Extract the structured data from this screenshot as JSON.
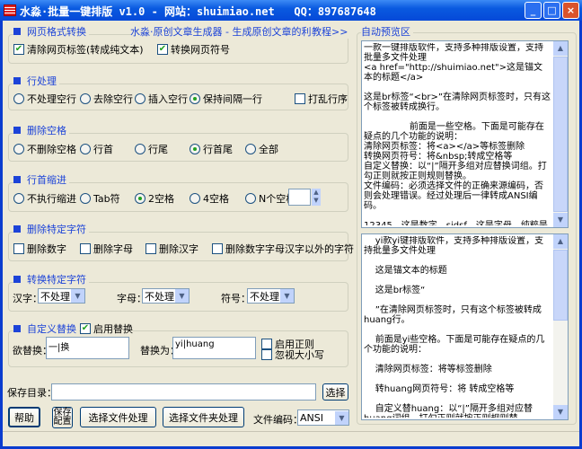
{
  "window": {
    "title": "水淼·批量一键排版 v1.0 - 网站：shuimiao.net   QQ：897687648",
    "minimize": "_",
    "maximize": "□",
    "close": "×"
  },
  "web_format": {
    "title": "网页格式转换",
    "promo_link": "水淼·原创文章生成器 - 生成原创文章的利器！",
    "tutorial_link": "教程>>",
    "options": [
      {
        "label": "清除网页标签(转成纯文本)",
        "checked": true
      },
      {
        "label": "转换网页符号",
        "checked": true
      }
    ]
  },
  "line_process": {
    "title": "行处理",
    "options": [
      {
        "label": "不处理空行",
        "selected": false
      },
      {
        "label": "去除空行",
        "selected": false
      },
      {
        "label": "插入空行",
        "selected": false
      },
      {
        "label": "保持间隔一行",
        "selected": true
      }
    ],
    "shuffle": {
      "label": "打乱行序",
      "checked": false
    }
  },
  "remove_spaces": {
    "title": "删除空格",
    "options": [
      {
        "label": "不删除空格",
        "selected": false
      },
      {
        "label": "行首",
        "selected": false
      },
      {
        "label": "行尾",
        "selected": false
      },
      {
        "label": "行首尾",
        "selected": true
      },
      {
        "label": "全部",
        "selected": false
      }
    ]
  },
  "indent": {
    "title": "行首缩进",
    "options": [
      {
        "label": "不执行缩进",
        "selected": false
      },
      {
        "label": "Tab符",
        "selected": false
      },
      {
        "label": "2空格",
        "selected": true
      },
      {
        "label": "4空格",
        "selected": false
      },
      {
        "label": "N个空格",
        "selected": false
      }
    ],
    "n_value": ""
  },
  "remove_chars": {
    "title": "删除特定字符",
    "options": [
      {
        "label": "删除数字",
        "checked": false
      },
      {
        "label": "删除字母",
        "checked": false
      },
      {
        "label": "删除汉字",
        "checked": false
      },
      {
        "label": "删除数字字母汉字以外的字符",
        "checked": false
      }
    ]
  },
  "convert_chars": {
    "title": "转换特定字符",
    "fields": [
      {
        "label": "汉字：",
        "value": "不处理"
      },
      {
        "label": "字母：",
        "value": "不处理"
      },
      {
        "label": "符号：",
        "value": "不处理"
      }
    ]
  },
  "custom_replace": {
    "title": "自定义替换",
    "enable": {
      "label": "启用替换",
      "checked": true
    },
    "find_label": "欲替换：",
    "find_value": "一|换",
    "replace_label": "替换为：",
    "replace_value": "yi|huang",
    "regex": {
      "label": "启用正则",
      "checked": false
    },
    "ignore_case": {
      "label": "忽视大小写",
      "checked": false
    }
  },
  "save": {
    "label": "保存目录：",
    "value": "",
    "browse": "选择"
  },
  "buttons": {
    "help": "帮助",
    "save_config": "保存配置",
    "process_files": "选择文件处理",
    "process_folder": "选择文件夹处理",
    "encoding_label": "文件编码：",
    "encoding_value": "ANSI"
  },
  "preview": {
    "title": "自动预览区",
    "source": "一款一键排版软件，支持多种排版设置，支持批量多文件处理\n<a href=\"http://shuimiao.net\">这是锚文本的标题</a>\n\n这是br标签“<br>”在清除网页标签时，只有这个标签被转成换行。\n\n                前面是一些空格。下面是可能存在疑点的几个功能的说明：\n清除网页标签：将<a></a>等标签删除\n转换网页符号：将&nbsp;转成空格等\n自定义替换：以“|”隔开多组对应替换词组。打勾正则就按正则规则替换。\n文件编码：必须选择文件的正确来源编码，否则会处理错误。经过处理后一律转成ANSI编码。\n\n12345，这是数字。sjdsf，这是字母。纯粹是为了方便设置。然后下面是多个空行",
    "result": "    yi款yi键排版软件，支持多种排版设置，支持批量多文件处理\n\n    这是锚文本的标题\n\n    这是br标签“\n\n    ”在清除网页标签时，只有这个标签被转成huang行。\n\n    前面是yi些空格。下面是可能存在疑点的几个功能的说明：\n\n    清除网页标签：将等标签删除\n\n    转huang网页符号：将 转成空格等\n\n    自定义替huang：以“|”隔开多组对应替huang词组。打勾正则就按正则规则替huang。\n\n    文件编码：必须选择文件的正确来源编码，否则会处理错误。经过处理后yi律转成ANSI编码。"
  },
  "colors": {
    "accent": "#1c43d8",
    "titlebar": "#0a5ae0",
    "face": "#ECE9D8"
  }
}
